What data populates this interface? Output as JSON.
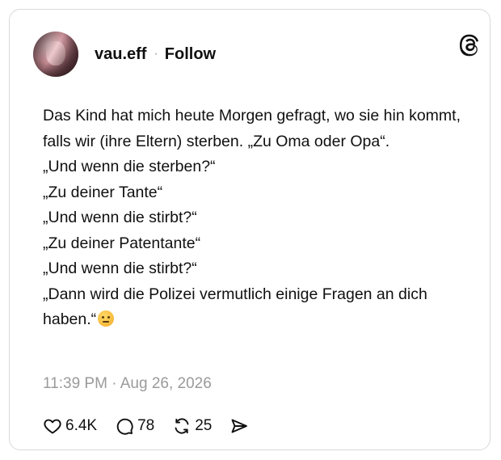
{
  "post": {
    "username": "vau.eff",
    "separator": "·",
    "follow_label": "Follow",
    "text": "Das Kind hat mich heute Morgen gefragt, wo sie hin kommt, falls wir (ihre Eltern) sterben. „Zu Oma oder Opa“.\n„Und wenn die sterben?“\n„Zu deiner Tante“\n„Und wenn die stirbt?“\n„Zu deiner Patentante“\n„Und wenn die stirbt?“\n„Dann wird die Polizei vermutlich einige Fragen an dich haben.“",
    "emoji": "face-with-raised-eyebrow",
    "timestamp": "11:39 PM · Aug 26, 2026"
  },
  "actions": {
    "likes": "6.4K",
    "comments": "78",
    "reposts": "25"
  },
  "icons": {
    "logo": "threads-logo-icon",
    "like": "heart-icon",
    "comment": "comment-bubble-icon",
    "repost": "repost-icon",
    "share": "share-send-icon"
  },
  "colors": {
    "text": "#101010",
    "muted": "#9a9a9a",
    "border": "#d9d9d9"
  }
}
